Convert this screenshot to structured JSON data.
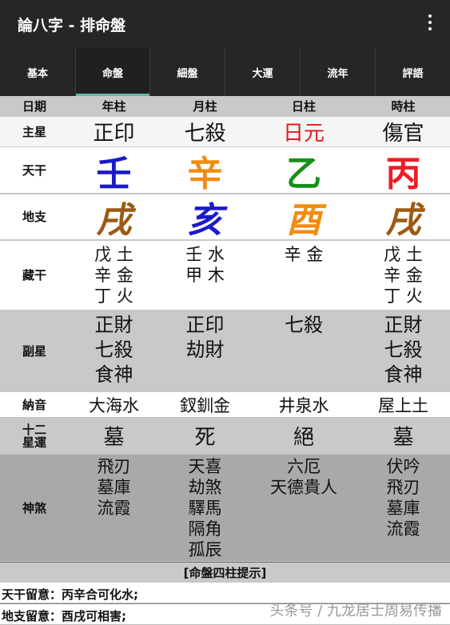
{
  "app_bar": {
    "title": "論八字 - 排命盤",
    "menu_icon": "more-vert-icon"
  },
  "tabs": [
    {
      "label": "基本"
    },
    {
      "label": "命盤",
      "active": true
    },
    {
      "label": "細盤"
    },
    {
      "label": "大運"
    },
    {
      "label": "流年"
    },
    {
      "label": "評語"
    }
  ],
  "header": {
    "label": "日期",
    "cols": [
      "年柱",
      "月柱",
      "日柱",
      "時柱"
    ]
  },
  "main_star": {
    "label": "主星",
    "cols": [
      "正印",
      "七殺",
      "日元",
      "傷官"
    ],
    "highlight_color": "#e8171b"
  },
  "heavenly_stems": {
    "label": "天干",
    "cols": [
      "壬",
      "辛",
      "乙",
      "丙"
    ],
    "colors": [
      "#1a1ac8",
      "#f28c10",
      "#168f16",
      "#ee1c24"
    ]
  },
  "earthly_branches": {
    "label": "地支",
    "cols": [
      "戌",
      "亥",
      "酉",
      "戌"
    ],
    "colors": [
      "#9c5a12",
      "#1a1ac8",
      "#f28c10",
      "#9c5a12"
    ]
  },
  "hidden_stems": {
    "label": "藏干",
    "cols": [
      [
        "戊 土",
        "辛 金",
        "丁 火"
      ],
      [
        "壬 水",
        "甲 木"
      ],
      [
        "辛 金"
      ],
      [
        "戊 土",
        "辛 金",
        "丁 火"
      ]
    ]
  },
  "sub_stars": {
    "label": "副星",
    "cols": [
      [
        "正財",
        "七殺",
        "食神"
      ],
      [
        "正印",
        "劫財"
      ],
      [
        "七殺"
      ],
      [
        "正財",
        "七殺",
        "食神"
      ]
    ]
  },
  "nayin": {
    "label": "納音",
    "cols": [
      "大海水",
      "釵釧金",
      "井泉水",
      "屋上土"
    ]
  },
  "twelve_stages": {
    "label_line1": "十二",
    "label_line2": "星運",
    "cols": [
      "墓",
      "死",
      "絕",
      "墓"
    ]
  },
  "shensha": {
    "label": "神煞",
    "cols": [
      [
        "飛刃",
        "墓庫",
        "流霞"
      ],
      [
        "天喜",
        "劫煞",
        "驛馬",
        "隔角",
        "孤辰"
      ],
      [
        "六厄",
        "天德貴人"
      ],
      [
        "伏吟",
        "飛刃",
        "墓庫",
        "流霞"
      ]
    ]
  },
  "tips_header": "[命盤四柱提示]",
  "notices": [
    "天干留意：丙辛合可化水;",
    "地支留意：酉戌可相害;"
  ],
  "watermark": "头条号 / 九龙居士周易传播"
}
